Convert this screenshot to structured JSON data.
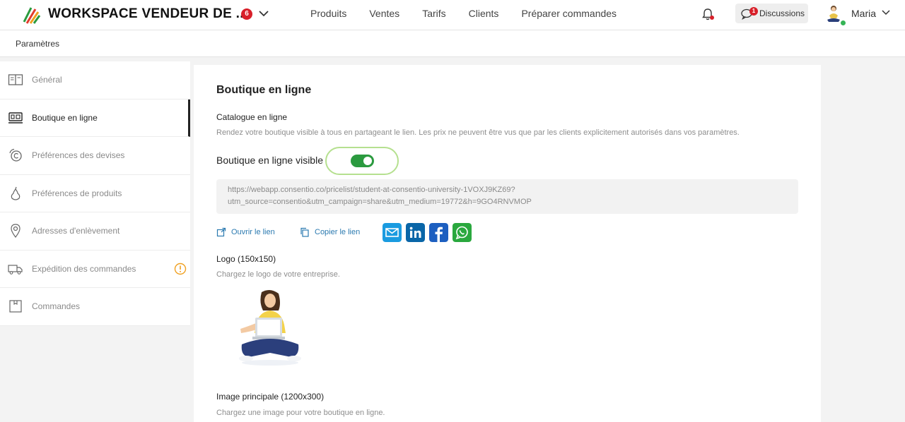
{
  "header": {
    "workspace_title": "WORKSPACE VENDEUR DE ...",
    "workspace_badge": "6",
    "nav": [
      "Produits",
      "Ventes",
      "Tarifs",
      "Clients",
      "Préparer commandes"
    ],
    "discussions_label": "Discussions",
    "discussions_badge": "1",
    "user_name": "Maria"
  },
  "breadcrumb": "Paramètres",
  "sidebar": {
    "items": [
      {
        "label": "Général",
        "icon": "book-icon"
      },
      {
        "label": "Boutique en ligne",
        "icon": "shop-icon"
      },
      {
        "label": "Préférences des devises",
        "icon": "currency-icon"
      },
      {
        "label": "Préférences de produits",
        "icon": "pear-icon"
      },
      {
        "label": "Adresses d'enlèvement",
        "icon": "location-pin-icon"
      },
      {
        "label": "Expédition des commandes",
        "icon": "truck-icon"
      },
      {
        "label": "Commandes",
        "icon": "box-icon"
      }
    ]
  },
  "main": {
    "title": "Boutique en ligne",
    "catalogue_label": "Catalogue en ligne",
    "catalogue_desc": "Rendez votre boutique visible à tous en partageant le lien. Les prix ne peuvent être vus que par les clients explicitement autorisés dans vos paramètres.",
    "visible_label": "Boutique en ligne visible",
    "visible_on": true,
    "url": "https://webapp.consentio.co/pricelist/student-at-consentio-university-1VOXJ9KZ69?utm_source=consentio&utm_campaign=share&utm_medium=19772&h=9GO4RNVMOP",
    "open_link": "Ouvrir le lien",
    "copy_link": "Copier le lien",
    "share_icons": [
      "email-icon",
      "linkedin-icon",
      "facebook-icon",
      "whatsapp-icon"
    ],
    "logo_label": "Logo (150x150)",
    "logo_desc": "Chargez le logo de votre entreprise.",
    "image_label": "Image principale (1200x300)",
    "image_desc": "Chargez une image pour votre boutique en ligne."
  },
  "colors": {
    "accent_green": "#2b9a3f",
    "link_blue": "#2b7ab0",
    "badge_red": "#d8202a"
  }
}
